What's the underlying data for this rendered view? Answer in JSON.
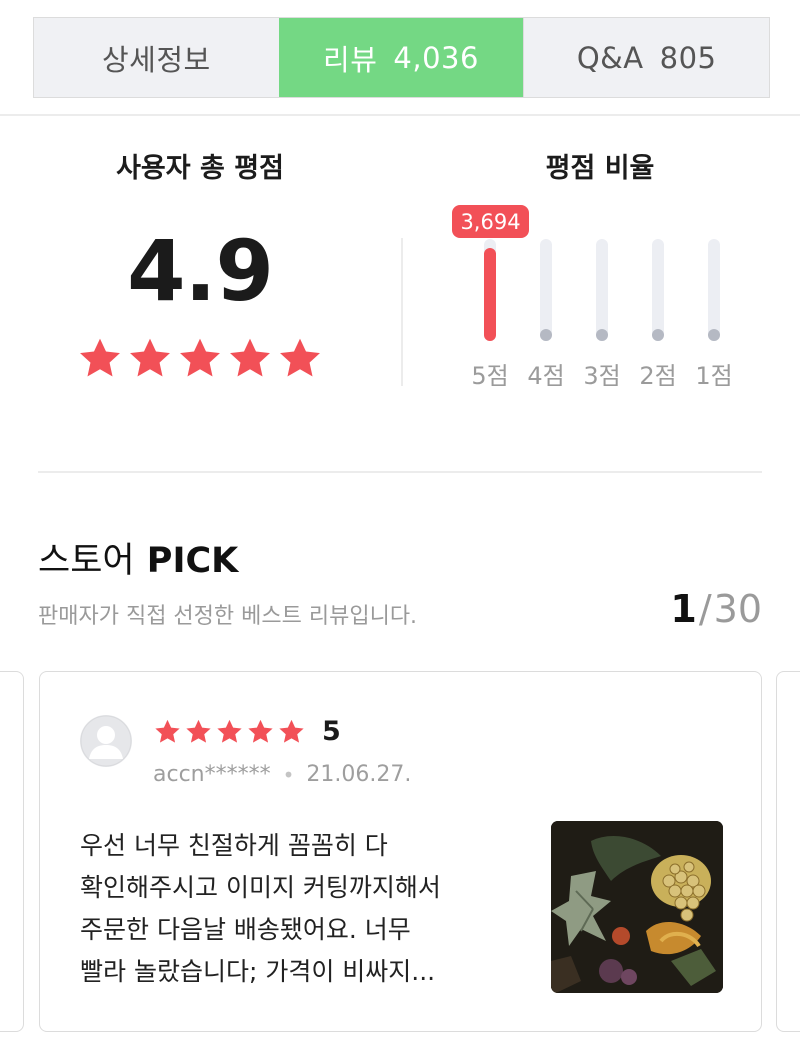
{
  "tabs": [
    {
      "label": "상세정보",
      "count": ""
    },
    {
      "label": "리뷰",
      "count": "4,036"
    },
    {
      "label": "Q&A",
      "count": "805"
    }
  ],
  "rating": {
    "title": "사용자 총 평점",
    "average": "4.9",
    "stars": 5
  },
  "ratio": {
    "title": "평점 비율",
    "top_count": "3,694",
    "bars": [
      {
        "label": "5점",
        "fraction": 0.915
      },
      {
        "label": "4점",
        "fraction": 0.0
      },
      {
        "label": "3점",
        "fraction": 0.0
      },
      {
        "label": "2점",
        "fraction": 0.0
      },
      {
        "label": "1점",
        "fraction": 0.0
      }
    ]
  },
  "store_pick": {
    "title_kr": "스토어",
    "title_en": "PICK",
    "subtitle": "판매자가 직접 선정한 베스트 리뷰입니다.",
    "page_current": "1",
    "page_sep": "/",
    "page_total": "30"
  },
  "review": {
    "stars": 5,
    "score": "5",
    "user": "accn******",
    "date": "21.06.27.",
    "lines": [
      "우선 너무 친절하게 꼼꼼히 다",
      "확인해주시고 이미지 커팅까지해서",
      "주문한 다음날 배송됐어요. 너무",
      "빨라 놀랐습니다; 가격이 비싸지..."
    ]
  },
  "colors": {
    "active_tab": "#74d884",
    "star": "#f25057",
    "bar_top": "#f25057",
    "bar_track": "#eceef3"
  }
}
